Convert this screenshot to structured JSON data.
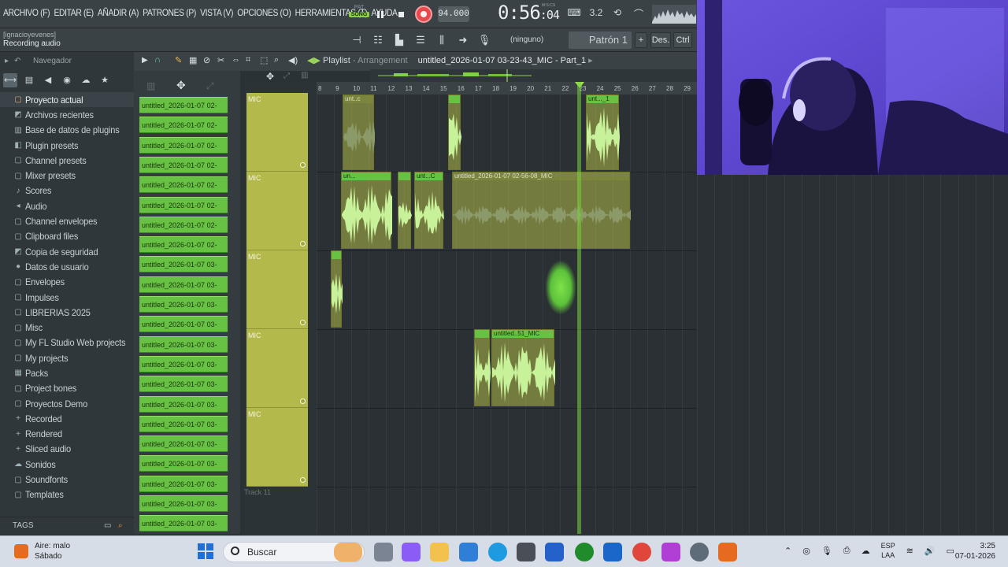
{
  "menu": [
    "ARCHIVO (F)",
    "EDITAR (E)",
    "AÑADIR (A)",
    "PATRONES (P)",
    "VISTA (V)",
    "OPCIONES (O)",
    "HERRAMIENTAS (T)",
    "AYUDA"
  ],
  "transport": {
    "pat_label": "PAT",
    "song_label": "SONG",
    "tempo": "94.000",
    "time_main": "0:56",
    "time_sub": ":04",
    "time_units": "M:S:CS"
  },
  "hint": {
    "user": "[ignacioyevenes]",
    "status": "Recording audio"
  },
  "toolbar2": {
    "ninguno": "(ninguno)",
    "pattern": "Patrón 1",
    "plus": "+",
    "des": "Des.",
    "ctrl": "Ctrl"
  },
  "browser": {
    "title": "Navegador",
    "items": [
      {
        "icon": "folder-icon",
        "label": "Proyecto actual"
      },
      {
        "icon": "recent-folder-icon",
        "label": "Archivos recientes"
      },
      {
        "icon": "database-icon",
        "label": "Base de datos de plugins"
      },
      {
        "icon": "plugin-icon",
        "label": "Plugin presets"
      },
      {
        "icon": "folder-icon",
        "label": "Channel presets"
      },
      {
        "icon": "folder-icon",
        "label": "Mixer presets"
      },
      {
        "icon": "note-icon",
        "label": "Scores"
      },
      {
        "icon": "audio-icon",
        "label": "Audio"
      },
      {
        "icon": "folder-icon",
        "label": "Channel envelopes"
      },
      {
        "icon": "folder-icon",
        "label": "Clipboard files"
      },
      {
        "icon": "recent-folder-icon",
        "label": "Copia de seguridad"
      },
      {
        "icon": "user-icon",
        "label": "Datos de usuario"
      },
      {
        "icon": "folder-icon",
        "label": "Envelopes"
      },
      {
        "icon": "folder-icon",
        "label": "Impulses"
      },
      {
        "icon": "folder-icon",
        "label": "LIBRERIAS 2025"
      },
      {
        "icon": "folder-icon",
        "label": "Misc"
      },
      {
        "icon": "folder-icon",
        "label": "My FL Studio Web projects"
      },
      {
        "icon": "folder-icon",
        "label": "My projects"
      },
      {
        "icon": "packs-icon",
        "label": "Packs"
      },
      {
        "icon": "folder-icon",
        "label": "Project bones"
      },
      {
        "icon": "folder-icon",
        "label": "Proyectos Demo"
      },
      {
        "icon": "plus-icon",
        "label": "Recorded"
      },
      {
        "icon": "plus-icon",
        "label": "Rendered"
      },
      {
        "icon": "plus-icon",
        "label": "Sliced audio"
      },
      {
        "icon": "cloud-icon",
        "label": "Sonidos"
      },
      {
        "icon": "folder-icon",
        "label": "Soundfonts"
      },
      {
        "icon": "folder-icon",
        "label": "Templates"
      }
    ],
    "tags": "TAGS"
  },
  "clips_list": [
    "untitled_2026-01-07 02-",
    "untitled_2026-01-07 02-",
    "untitled_2026-01-07 02-",
    "untitled_2026-01-07 02-",
    "untitled_2026-01-07 02-",
    "untitled_2026-01-07 02-",
    "untitled_2026-01-07 02-",
    "untitled_2026-01-07 02-",
    "untitled_2026-01-07 03-",
    "untitled_2026-01-07 03-",
    "untitled_2026-01-07 03-",
    "untitled_2026-01-07 03-",
    "untitled_2026-01-07 03-",
    "untitled_2026-01-07 03-",
    "untitled_2026-01-07 03-",
    "untitled_2026-01-07 03-",
    "untitled_2026-01-07 03-",
    "untitled_2026-01-07 03-",
    "untitled_2026-01-07 03-",
    "untitled_2026-01-07 03-",
    "untitled_2026-01-07 03-",
    "untitled_2026-01-07 03-"
  ],
  "playlist": {
    "label": "Playlist",
    "sep": " - ",
    "mode": "Arrangement",
    "file": "untitled_2026-01-07 03-23-43_MIC - Part_1",
    "ruler": [
      "8",
      "9",
      "10",
      "11",
      "12",
      "13",
      "14",
      "15",
      "16",
      "17",
      "18",
      "19",
      "20",
      "21",
      "22",
      "23",
      "24",
      "25",
      "26",
      "27",
      "28",
      "29"
    ],
    "tracks": [
      "MIC",
      "MIC",
      "MIC",
      "MIC",
      "MIC"
    ],
    "empty_track": "Track 11",
    "clip_labels": {
      "c1": "unt..c",
      "c2": "un...",
      "c3": "unt..._1",
      "c4": "un...",
      "c5": "unt...C",
      "c6": "untitled_2026-01-07 02-56-08_MIC",
      "c7": "untitled..51_MIC"
    }
  },
  "taskbar": {
    "weather_title": "Aire: malo",
    "weather_sub": "Sábado",
    "search": "Buscar",
    "lang1": "ESP",
    "lang2": "LAA",
    "time": "3:25",
    "date": "07-01-2026"
  },
  "colors": {
    "accent_green": "#67c142",
    "track_olive": "#b3b94b",
    "record_red": "#e8494d"
  }
}
